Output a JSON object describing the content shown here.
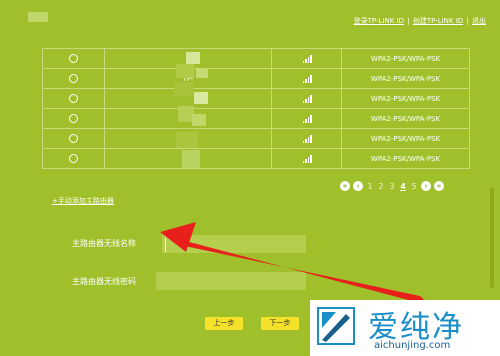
{
  "header": {
    "links": [
      "登录TP-LINK ID",
      "创建TP-LINK ID",
      "退出"
    ]
  },
  "network_table": {
    "rows": [
      {
        "name": "",
        "security": "WPA2-PSK/WPA-PSK"
      },
      {
        "name": "TP-",
        "security": "WPA2-PSK/WPA-PSK"
      },
      {
        "name": "",
        "security": "WPA2-PSK/WPA-PSK"
      },
      {
        "name": "",
        "security": "WPA2-PSK/WPA-PSK"
      },
      {
        "name": "C",
        "security": "WPA2-PSK/WPA-PSK"
      },
      {
        "name": "Cl",
        "security": "WPA2-PSK/WPA-PSK"
      }
    ]
  },
  "pagination": {
    "pages": [
      "1",
      "2",
      "3",
      "4",
      "5"
    ],
    "current": "4"
  },
  "form": {
    "add_link": "+手动添加主路由器",
    "ssid_label": "主路由器无线名称",
    "ssid_value": "",
    "password_label": "主路由器无线密码",
    "password_value": ""
  },
  "buttons": {
    "prev": "上一步",
    "next": "下一步"
  },
  "watermark": {
    "text": "爱纯净",
    "url": "aichunjing.com"
  },
  "colors": {
    "background": "#9fc02a",
    "button": "#f5e02a",
    "arrow": "#e8201c"
  }
}
